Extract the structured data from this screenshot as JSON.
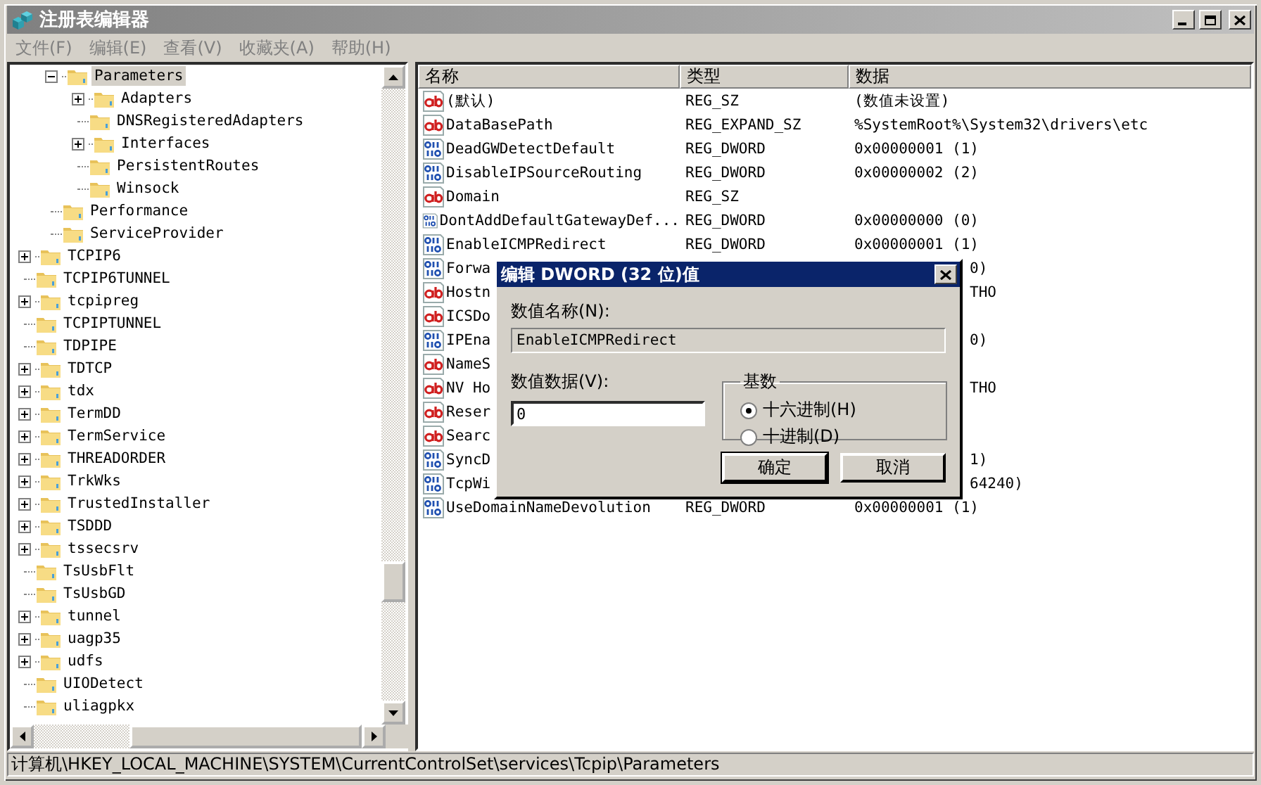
{
  "window": {
    "title": "注册表编辑器"
  },
  "menu": [
    "文件(F)",
    "编辑(E)",
    "查看(V)",
    "收藏夹(A)",
    "帮助(H)"
  ],
  "tree": {
    "items": [
      {
        "children": [
          {
            "label": "Parameters",
            "selected": true,
            "expandable": true,
            "expanded": true,
            "children": [
              {
                "label": "Adapters",
                "selected": false,
                "expandable": true,
                "expanded": false
              },
              {
                "label": "DNSRegisteredAdapters",
                "selected": false,
                "expandable": false
              },
              {
                "label": "Interfaces",
                "selected": false,
                "expandable": true,
                "expanded": false
              },
              {
                "label": "PersistentRoutes",
                "selected": false,
                "expandable": false
              },
              {
                "label": "Winsock",
                "selected": false,
                "expandable": false
              }
            ]
          },
          {
            "label": "Performance",
            "selected": false,
            "expandable": false
          },
          {
            "label": "ServiceProvider",
            "selected": false,
            "expandable": false
          }
        ]
      },
      {
        "label": "TCPIP6",
        "selected": false,
        "expandable": true,
        "expanded": false
      },
      {
        "label": "TCPIP6TUNNEL",
        "selected": false,
        "expandable": false
      },
      {
        "label": "tcpipreg",
        "selected": false,
        "expandable": true,
        "expanded": false
      },
      {
        "label": "TCPIPTUNNEL",
        "selected": false,
        "expandable": false
      },
      {
        "label": "TDPIPE",
        "selected": false,
        "expandable": false
      },
      {
        "label": "TDTCP",
        "selected": false,
        "expandable": true,
        "expanded": false
      },
      {
        "label": "tdx",
        "selected": false,
        "expandable": true,
        "expanded": false
      },
      {
        "label": "TermDD",
        "selected": false,
        "expandable": true,
        "expanded": false
      },
      {
        "label": "TermService",
        "selected": false,
        "expandable": true,
        "expanded": false
      },
      {
        "label": "THREADORDER",
        "selected": false,
        "expandable": true,
        "expanded": false
      },
      {
        "label": "TrkWks",
        "selected": false,
        "expandable": true,
        "expanded": false
      },
      {
        "label": "TrustedInstaller",
        "selected": false,
        "expandable": true,
        "expanded": false
      },
      {
        "label": "TSDDD",
        "selected": false,
        "expandable": true,
        "expanded": false
      },
      {
        "label": "tssecsrv",
        "selected": false,
        "expandable": true,
        "expanded": false
      },
      {
        "label": "TsUsbFlt",
        "selected": false,
        "expandable": false
      },
      {
        "label": "TsUsbGD",
        "selected": false,
        "expandable": false
      },
      {
        "label": "tunnel",
        "selected": false,
        "expandable": true,
        "expanded": false
      },
      {
        "label": "uagp35",
        "selected": false,
        "expandable": true,
        "expanded": false
      },
      {
        "label": "udfs",
        "selected": false,
        "expandable": true,
        "expanded": false
      },
      {
        "label": "UIODetect",
        "selected": false,
        "expandable": false
      },
      {
        "label": "uliagpkx",
        "selected": false,
        "expandable": false
      }
    ]
  },
  "list": {
    "columns": [
      "名称",
      "类型",
      "数据"
    ],
    "rows": [
      {
        "kind": "string",
        "name": "(默认)",
        "type": "REG_SZ",
        "data": "(数值未设置)"
      },
      {
        "kind": "string",
        "name": "DataBasePath",
        "type": "REG_EXPAND_SZ",
        "data": "%SystemRoot%\\System32\\drivers\\etc"
      },
      {
        "kind": "dword",
        "name": "DeadGWDetectDefault",
        "type": "REG_DWORD",
        "data": "0x00000001 (1)"
      },
      {
        "kind": "dword",
        "name": "DisableIPSourceRouting",
        "type": "REG_DWORD",
        "data": "0x00000002 (2)"
      },
      {
        "kind": "string",
        "name": "Domain",
        "type": "REG_SZ"
      },
      {
        "kind": "dword",
        "name": "DontAddDefaultGatewayDef...",
        "type": "REG_DWORD",
        "data": "0x00000000 (0)"
      },
      {
        "kind": "dword",
        "name": "EnableICMPRedirect",
        "type": "REG_DWORD",
        "data": "0x00000001 (1)"
      },
      {
        "kind": "dword",
        "name": "Forwa",
        "data": "0)"
      },
      {
        "kind": "string",
        "name": "Hostn",
        "data": "THO"
      },
      {
        "kind": "string",
        "name": "ICSDo"
      },
      {
        "kind": "dword",
        "name": "IPEna",
        "data": "0)"
      },
      {
        "kind": "string",
        "name": "NameS"
      },
      {
        "kind": "string",
        "name": "NV Ho",
        "data": "THO"
      },
      {
        "kind": "string",
        "name": "Reser"
      },
      {
        "kind": "string",
        "name": "Searc"
      },
      {
        "kind": "dword",
        "name": "SyncD",
        "data": "1)"
      },
      {
        "kind": "dword",
        "name": "TcpWi",
        "data": "64240)"
      },
      {
        "kind": "dword",
        "name": "UseDomainNameDevolution",
        "type": "REG_DWORD",
        "data": "0x00000001 (1)"
      }
    ]
  },
  "dialog": {
    "title": "编辑 DWORD (32 位)值",
    "name_label": "数值名称(N):",
    "name_value": "EnableICMPRedirect",
    "data_label": "数值数据(V):",
    "data_value": "0",
    "base": {
      "label": "基数",
      "options": [
        {
          "label": "十六进制(H)",
          "selected": true
        },
        {
          "label": "十进制(D)",
          "selected": false
        }
      ]
    },
    "buttons": [
      {
        "label": "确定",
        "default": true
      },
      {
        "label": "取消",
        "default": false
      }
    ]
  },
  "status_bar": "计算机\\HKEY_LOCAL_MACHINE\\SYSTEM\\CurrentControlSet\\services\\Tcpip\\Parameters"
}
